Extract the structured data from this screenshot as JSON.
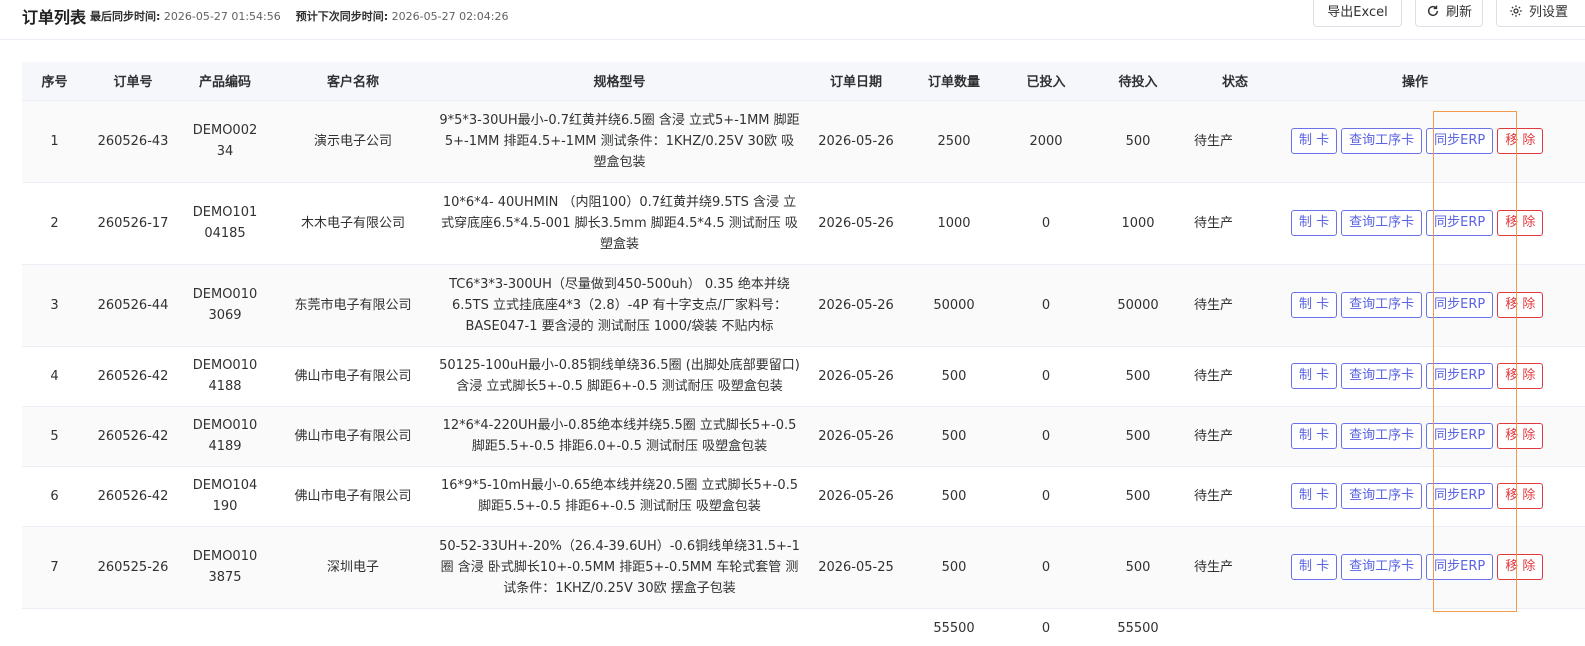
{
  "header": {
    "title": "订单列表",
    "last_sync_label": "最后同步时间:",
    "last_sync_value": "2026-05-27 01:54:56",
    "next_sync_label": "预计下次同步时间:",
    "next_sync_value": "2026-05-27 02:04:26",
    "export_label": "导出Excel",
    "refresh_label": "刷新",
    "columns_label": "列设置"
  },
  "table": {
    "columns": [
      "序号",
      "订单号",
      "产品编码",
      "客户名称",
      "规格型号",
      "订单日期",
      "订单数量",
      "已投入",
      "待投入",
      "状态",
      "操作"
    ],
    "rows": [
      {
        "seq": "1",
        "order_no": "260526-43",
        "product_code": "DEMO00234",
        "customer": "演示电子公司",
        "spec": "9*5*3-30UH最小-0.7红黄并绕6.5圈 含浸 立式5+-1MM 脚距5+-1MM 排距4.5+-1MM 测试条件：1KHZ/0.25V 30欧 吸塑盒包装",
        "date": "2026-05-26",
        "qty": "2500",
        "invested": "2000",
        "pending": "500",
        "status": "待生产"
      },
      {
        "seq": "2",
        "order_no": "260526-17",
        "product_code": "DEMO10104185",
        "customer": "木木电子有限公司",
        "spec": "10*6*4- 40UHMIN （内阻100）0.7红黄并绕9.5TS 含浸 立式穿底座6.5*4.5-001 脚长3.5mm 脚距4.5*4.5 测试耐压 吸塑盒装",
        "date": "2026-05-26",
        "qty": "1000",
        "invested": "0",
        "pending": "1000",
        "status": "待生产"
      },
      {
        "seq": "3",
        "order_no": "260526-44",
        "product_code": "DEMO0103069",
        "customer": "东莞市电子有限公司",
        "spec": "TC6*3*3-300UH（尽量做到450-500uh） 0.35 绝本并绕6.5TS 立式挂底座4*3（2.8）-4P 有十字支点/厂家料号：BASE047-1 要含浸的 测试耐压 1000/袋装 不贴内标",
        "date": "2026-05-26",
        "qty": "50000",
        "invested": "0",
        "pending": "50000",
        "status": "待生产"
      },
      {
        "seq": "4",
        "order_no": "260526-42",
        "product_code": "DEMO0104188",
        "customer": "佛山市电子有限公司",
        "spec": "50125-100uH最小-0.85铜线单绕36.5圈 (出脚处底部要留口) 含浸 立式脚长5+-0.5 脚距6+-0.5 测试耐压 吸塑盒包装",
        "date": "2026-05-26",
        "qty": "500",
        "invested": "0",
        "pending": "500",
        "status": "待生产"
      },
      {
        "seq": "5",
        "order_no": "260526-42",
        "product_code": "DEMO0104189",
        "customer": "佛山市电子有限公司",
        "spec": "12*6*4-220UH最小-0.85绝本线并绕5.5圈 立式脚长5+-0.5 脚距5.5+-0.5 排距6.0+-0.5 测试耐压 吸塑盒包装",
        "date": "2026-05-26",
        "qty": "500",
        "invested": "0",
        "pending": "500",
        "status": "待生产"
      },
      {
        "seq": "6",
        "order_no": "260526-42",
        "product_code": "DEMO104190",
        "customer": "佛山市电子有限公司",
        "spec": "16*9*5-10mH最小-0.65绝本线并绕20.5圈 立式脚长5+-0.5 脚距5.5+-0.5 排距6+-0.5 测试耐压 吸塑盒包装",
        "date": "2026-05-26",
        "qty": "500",
        "invested": "0",
        "pending": "500",
        "status": "待生产"
      },
      {
        "seq": "7",
        "order_no": "260525-26",
        "product_code": "DEMO0103875",
        "customer": "深圳电子",
        "spec": "50-52-33UH+-20%（26.4-39.6UH）-0.6铜线单绕31.5+-1圈 含浸 卧式脚长10+-0.5MM 排距5+-0.5MM 车轮式套管 测试条件：1KHZ/0.25V 30欧 摆盒子包装",
        "date": "2026-05-25",
        "qty": "500",
        "invested": "0",
        "pending": "500",
        "status": "待生产"
      }
    ],
    "actions": {
      "make_card": "制 卡",
      "query_card": "查询工序卡",
      "sync_erp": "同步ERP",
      "remove": "移 除"
    },
    "totals": {
      "qty": "55500",
      "invested": "0",
      "pending": "55500"
    }
  },
  "colors": {
    "primary": "#5a63e0",
    "danger": "#e0393e",
    "highlight": "#f49a4d",
    "header_bg": "#f5f7fa"
  }
}
